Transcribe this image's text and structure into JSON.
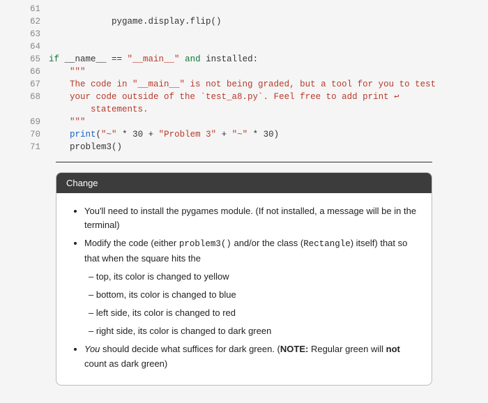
{
  "code": {
    "lines": [
      {
        "n": "61",
        "html": ""
      },
      {
        "n": "62",
        "html": "            pygame.display.flip()"
      },
      {
        "n": "63",
        "html": ""
      },
      {
        "n": "64",
        "html": ""
      },
      {
        "n": "65",
        "html": "<span class='tok-kw'>if</span> __name__ == <span class='tok-str'>\"__main__\"</span> <span class='tok-kw'>and</span> installed:"
      },
      {
        "n": "66",
        "html": "    <span class='tok-str'>\"\"\"</span>"
      },
      {
        "n": "67",
        "html": "    <span class='tok-str'>The code in \"__main__\" is not being graded, but a tool for you to test</span>"
      },
      {
        "n": "68",
        "html": "    <span class='tok-str'>your code outside of the `test_a8.py`. Feel free to add print ↩</span>"
      },
      {
        "n": "",
        "html": "        <span class='tok-str'>statements.</span>"
      },
      {
        "n": "69",
        "html": "    <span class='tok-str'>\"\"\"</span>"
      },
      {
        "n": "70",
        "html": "    <span class='tok-fn'>print</span>(<span class='tok-str'>\"~\"</span> * 30 + <span class='tok-str'>\"Problem 3\"</span> + <span class='tok-str'>\"~\"</span> * 30)"
      },
      {
        "n": "71",
        "html": "    problem3()"
      }
    ]
  },
  "panel": {
    "title": "Change",
    "bullet1_a": "You'll need to install the pygames module.  (If not installed, a message will be in the terminal)",
    "bullet2_pre": "Modify the code (either ",
    "bullet2_code1": "problem3()",
    "bullet2_mid": " and/or the class (",
    "bullet2_code2": "Rectangle",
    "bullet2_post": ") itself) that so that when the square hits the",
    "sub_top": "top, its color is changed to yellow",
    "sub_bottom": "bottom, its color is changed to blue",
    "sub_left": "left side, its color is changed to red",
    "sub_right": "right side, its color is changed to dark green",
    "bullet3_you": "You",
    "bullet3_mid": " should decide what suffices for dark green.  (",
    "bullet3_note": "NOTE:",
    "bullet3_after": " Regular green will ",
    "bullet3_not": "not",
    "bullet3_end": " count as dark green)"
  }
}
